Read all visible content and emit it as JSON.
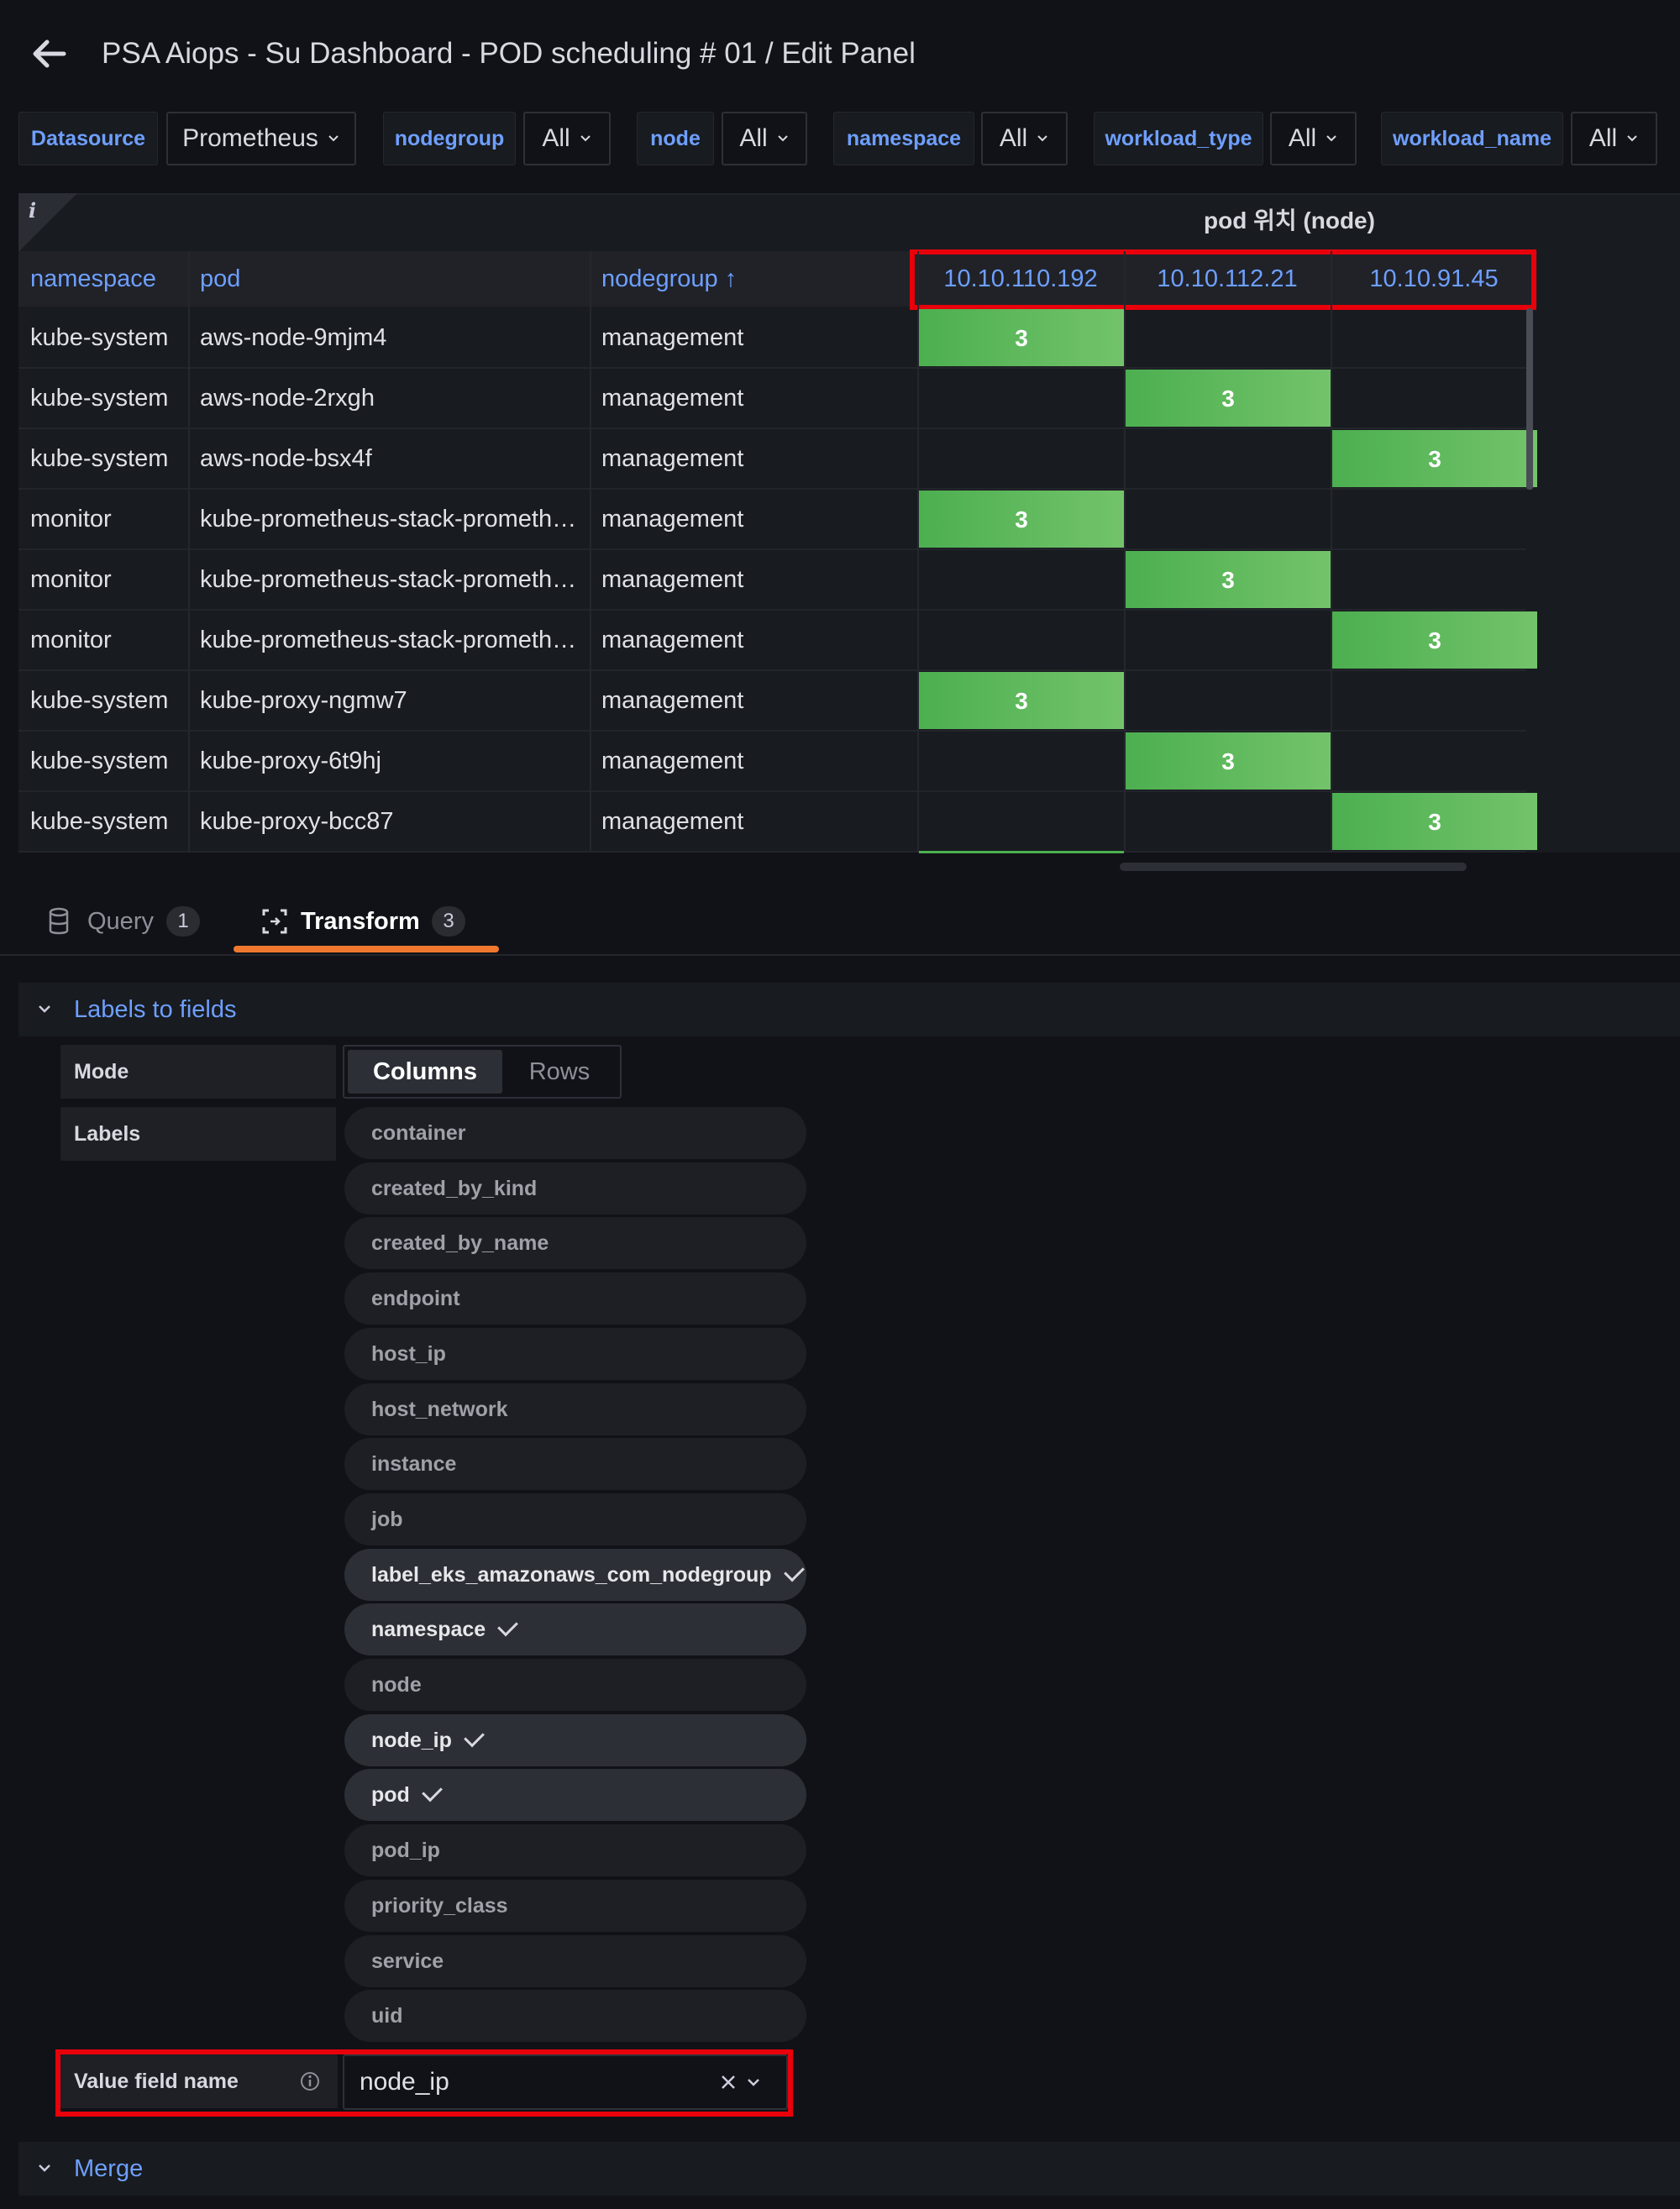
{
  "header": {
    "title": "PSA Aiops - Su Dashboard - POD scheduling # 01 / Edit Panel"
  },
  "variables": [
    {
      "label": "Datasource",
      "value": "Prometheus"
    },
    {
      "label": "nodegroup",
      "value": "All"
    },
    {
      "label": "node",
      "value": "All"
    },
    {
      "label": "namespace",
      "value": "All"
    },
    {
      "label": "workload_type",
      "value": "All"
    },
    {
      "label": "workload_name",
      "value": "All"
    }
  ],
  "panel": {
    "info_icon": "i",
    "group_header": "pod 위치 (node)",
    "columns": {
      "namespace": "namespace",
      "pod": "pod",
      "nodegroup": "nodegroup",
      "sort_arrow": "↑"
    },
    "node_ips": [
      "10.10.110.192",
      "10.10.112.21",
      "10.10.91.45"
    ],
    "rows": [
      {
        "namespace": "kube-system",
        "pod": "aws-node-9mjm4",
        "nodegroup": "management",
        "value": "3",
        "node_index": 0
      },
      {
        "namespace": "kube-system",
        "pod": "aws-node-2rxgh",
        "nodegroup": "management",
        "value": "3",
        "node_index": 1
      },
      {
        "namespace": "kube-system",
        "pod": "aws-node-bsx4f",
        "nodegroup": "management",
        "value": "3",
        "node_index": 2
      },
      {
        "namespace": "monitor",
        "pod": "kube-prometheus-stack-prometh…",
        "nodegroup": "management",
        "value": "3",
        "node_index": 0
      },
      {
        "namespace": "monitor",
        "pod": "kube-prometheus-stack-prometh…",
        "nodegroup": "management",
        "value": "3",
        "node_index": 1
      },
      {
        "namespace": "monitor",
        "pod": "kube-prometheus-stack-prometh…",
        "nodegroup": "management",
        "value": "3",
        "node_index": 2
      },
      {
        "namespace": "kube-system",
        "pod": "kube-proxy-ngmw7",
        "nodegroup": "management",
        "value": "3",
        "node_index": 0
      },
      {
        "namespace": "kube-system",
        "pod": "kube-proxy-6t9hj",
        "nodegroup": "management",
        "value": "3",
        "node_index": 1
      },
      {
        "namespace": "kube-system",
        "pod": "kube-proxy-bcc87",
        "nodegroup": "management",
        "value": "3",
        "node_index": 2
      }
    ]
  },
  "tabs": [
    {
      "label": "Query",
      "count": "1",
      "active": false
    },
    {
      "label": "Transform",
      "count": "3",
      "active": true
    }
  ],
  "labels_to_fields": {
    "title": "Labels to fields",
    "mode_label": "Mode",
    "mode_options": [
      "Columns",
      "Rows"
    ],
    "mode_selected": "Columns",
    "labels_label": "Labels",
    "labels": [
      {
        "name": "container",
        "selected": false
      },
      {
        "name": "created_by_kind",
        "selected": false
      },
      {
        "name": "created_by_name",
        "selected": false
      },
      {
        "name": "endpoint",
        "selected": false
      },
      {
        "name": "host_ip",
        "selected": false
      },
      {
        "name": "host_network",
        "selected": false
      },
      {
        "name": "instance",
        "selected": false
      },
      {
        "name": "job",
        "selected": false
      },
      {
        "name": "label_eks_amazonaws_com_nodegroup",
        "selected": true
      },
      {
        "name": "namespace",
        "selected": true
      },
      {
        "name": "node",
        "selected": false
      },
      {
        "name": "node_ip",
        "selected": true
      },
      {
        "name": "pod",
        "selected": true
      },
      {
        "name": "pod_ip",
        "selected": false
      },
      {
        "name": "priority_class",
        "selected": false
      },
      {
        "name": "service",
        "selected": false
      },
      {
        "name": "uid",
        "selected": false
      }
    ],
    "value_field_label": "Value field name",
    "value_field_value": "node_ip"
  },
  "merge": {
    "title": "Merge"
  },
  "colors": {
    "accent": "#6e9fff",
    "cell_green": "#56b050",
    "tab_underline": "#f0782e",
    "highlight_red": "#e8000b"
  }
}
